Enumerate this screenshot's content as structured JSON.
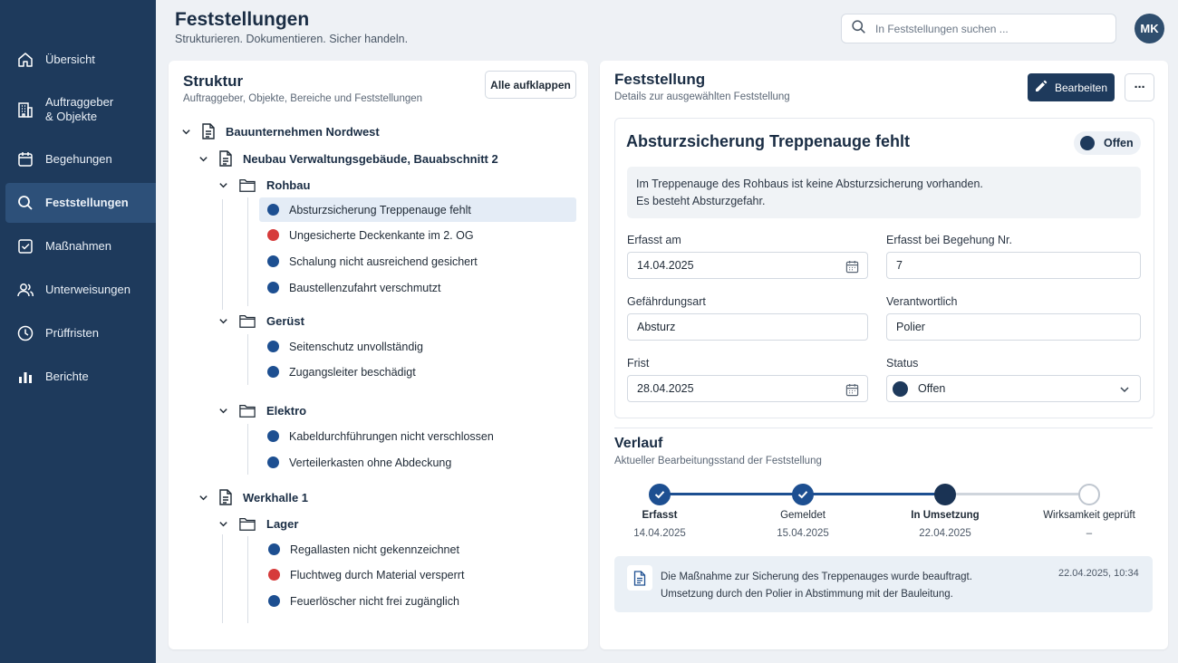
{
  "colors": {
    "sidebar_bg": "#1e3a5c",
    "sidebar_active": "#2d5079",
    "primary": "#1e3a5c",
    "status_blue": "#1d4f91",
    "status_red": "#d63b3b",
    "status_dark": "#1e3a5c"
  },
  "sidebar": {
    "items": [
      {
        "label": "Übersicht",
        "icon": "home-icon"
      },
      {
        "label": "Auftraggeber\n& Objekte",
        "icon": "building-icon"
      },
      {
        "label": "Begehungen",
        "icon": "calendar-icon"
      },
      {
        "label": "Feststellungen",
        "icon": "search-icon",
        "active": true
      },
      {
        "label": "Maßnahmen",
        "icon": "checkbox-icon"
      },
      {
        "label": "Unterweisungen",
        "icon": "users-icon"
      },
      {
        "label": "Prüffristen",
        "icon": "clock-icon"
      },
      {
        "label": "Berichte",
        "icon": "bar-chart-icon"
      }
    ]
  },
  "header": {
    "title": "Feststellungen",
    "subtitle": "Strukturieren. Dokumentieren. Sicher handeln.",
    "search_placeholder": "In Feststellungen suchen ...",
    "avatar_initials": "MK"
  },
  "structure": {
    "title": "Struktur",
    "subtitle": "Auftraggeber, Objekte, Bereiche und Feststellungen",
    "expand_all": "Alle aufklappen",
    "client": "Bauunternehmen Nordwest",
    "objects": [
      {
        "name": "Neubau Verwaltungsgebäude, Bauabschnitt 2",
        "areas": [
          {
            "name": "Rohbau",
            "findings": [
              {
                "label": "Absturzsicherung Treppenauge fehlt",
                "status": "blue",
                "selected": true
              },
              {
                "label": "Ungesicherte Deckenkante im 2. OG",
                "status": "red"
              },
              {
                "label": "Schalung nicht ausreichend gesichert",
                "status": "blue"
              },
              {
                "label": "Baustellenzufahrt verschmutzt",
                "status": "blue"
              }
            ]
          },
          {
            "name": "Gerüst",
            "findings": [
              {
                "label": "Seitenschutz unvollständig",
                "status": "blue"
              },
              {
                "label": "Zugangsleiter beschädigt",
                "status": "blue"
              }
            ]
          },
          {
            "name": "Elektro",
            "findings": [
              {
                "label": "Kabeldurchführungen nicht verschlossen",
                "status": "blue"
              },
              {
                "label": "Verteilerkasten ohne Abdeckung",
                "status": "blue"
              }
            ]
          }
        ]
      },
      {
        "name": "Werkhalle 1",
        "areas": [
          {
            "name": "Lager",
            "findings": [
              {
                "label": "Regallasten nicht gekennzeichnet",
                "status": "blue"
              },
              {
                "label": "Fluchtweg durch Material versperrt",
                "status": "red"
              },
              {
                "label": "Feuerlöscher nicht frei zugänglich",
                "status": "blue"
              }
            ]
          }
        ]
      }
    ]
  },
  "detail": {
    "title": "Feststellung",
    "subtitle": "Details zur ausgewählten Feststellung",
    "edit_label": "Bearbeiten",
    "more_label": "···",
    "finding_title": "Absturzsicherung Treppenauge fehlt",
    "status_pill": "Offen",
    "description_line1": "Im Treppenauge des Rohbaus ist keine Absturzsicherung vorhanden.",
    "description_line2": "Es besteht Absturzgefahr.",
    "fields": {
      "erfasst_am_label": "Erfasst am",
      "erfasst_am_value": "14.04.2025",
      "begehung_label": "Erfasst bei Begehung Nr.",
      "begehung_value": "7",
      "gefaehrdung_label": "Gefährdungsart",
      "gefaehrdung_value": "Absturz",
      "verantwortlich_label": "Verantwortlich",
      "verantwortlich_value": "Polier",
      "frist_label": "Frist",
      "frist_value": "28.04.2025",
      "status_label": "Status",
      "status_value": "Offen"
    }
  },
  "verlauf": {
    "title": "Verlauf",
    "subtitle": "Aktueller Bearbeitungsstand der Feststellung",
    "steps": [
      {
        "label": "Erfasst",
        "date": "14.04.2025",
        "state": "done"
      },
      {
        "label": "Gemeldet",
        "date": "15.04.2025",
        "state": "done"
      },
      {
        "label": "In Umsetzung",
        "date": "22.04.2025",
        "state": "current"
      },
      {
        "label": "Wirksamkeit geprüft",
        "date": "–",
        "state": "pending"
      }
    ],
    "note_line1": "Die Maßnahme zur Sicherung des Treppenauges wurde beauftragt.",
    "note_line2": "Umsetzung durch den Polier in Abstimmung mit der Bauleitung.",
    "note_time": "22.04.2025, 10:34"
  }
}
